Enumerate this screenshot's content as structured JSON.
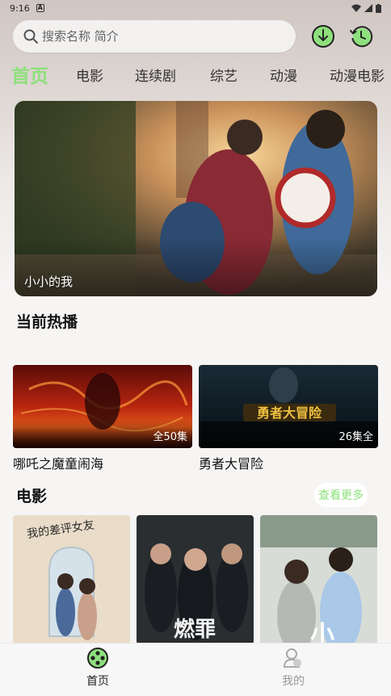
{
  "status": {
    "time": "9:16",
    "notification_badge": "A"
  },
  "search": {
    "placeholder": "搜索名称 简介"
  },
  "tabs": [
    "首页",
    "电影",
    "连续剧",
    "综艺",
    "动漫",
    "动漫电影"
  ],
  "banner": {
    "caption": "小小的我"
  },
  "hot": {
    "title": "当前热播",
    "items": [
      {
        "title": "哪吒之魔童闹海",
        "badge": "全50集",
        "logo_text": ""
      },
      {
        "title": "勇者大冒险",
        "badge": "26集全",
        "logo_text": "勇者大冒险"
      }
    ]
  },
  "movies": {
    "title": "电影",
    "more_label": "查看更多",
    "posters": [
      {
        "poster_text": "我的差评女友"
      },
      {
        "poster_text": "燃罪"
      },
      {
        "poster_text": "小"
      }
    ]
  },
  "nav": {
    "home_label": "首页",
    "mine_label": "我的"
  },
  "colors": {
    "accent": "#8ee07c"
  }
}
